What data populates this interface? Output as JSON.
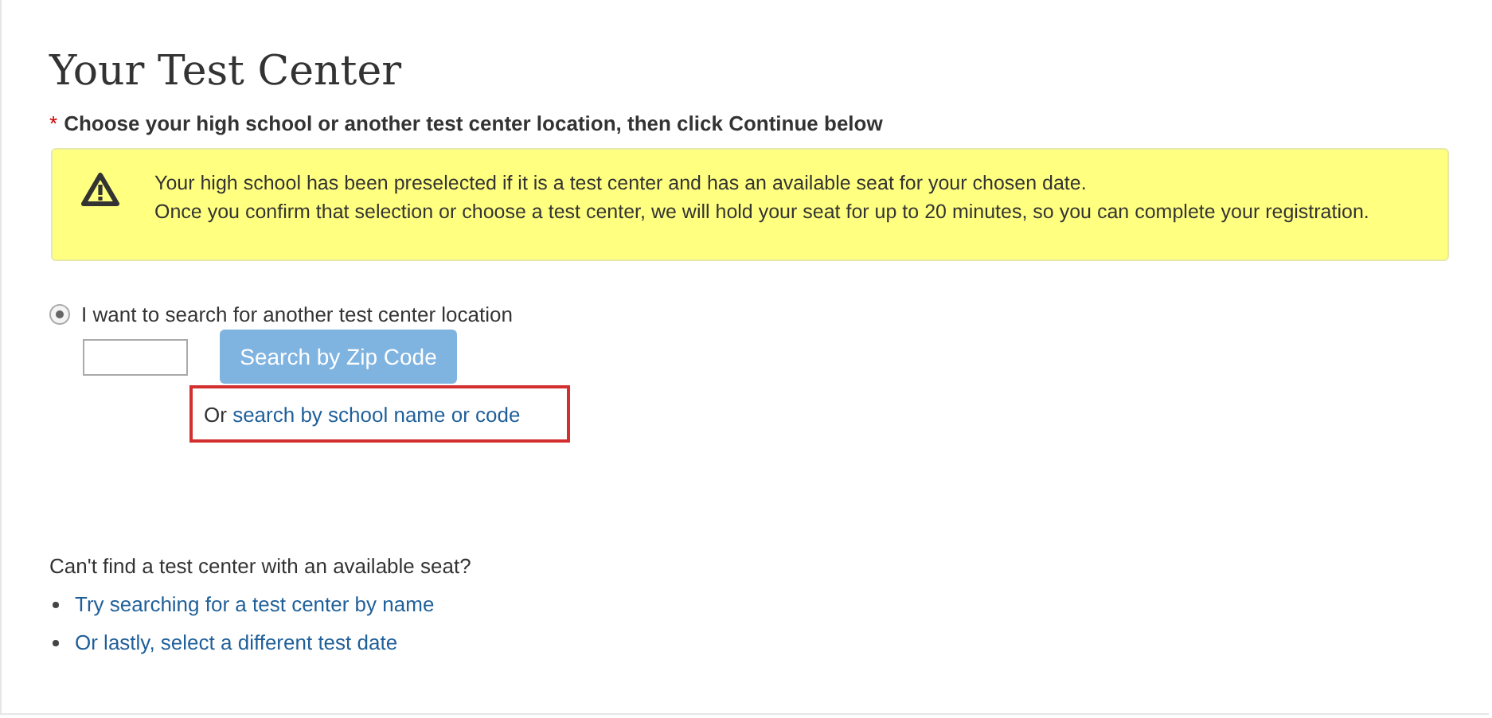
{
  "title": "Your Test Center",
  "instruction": {
    "required_mark": "*",
    "text": "Choose your high school or another test center location, then click Continue below"
  },
  "notice": {
    "lines": [
      "Your high school has been preselected if it is a test center and has an available seat for your chosen date.",
      "Once you confirm that selection or choose a test center, we will hold your seat for up to 20 minutes, so you can complete your registration."
    ]
  },
  "search_option": {
    "label": "I want to search for another test center location",
    "selected": true
  },
  "zip_button": {
    "label": "Search by Zip Code"
  },
  "alternative": {
    "prefix": "Or",
    "link": "search by school name or code",
    "highlighted": true
  },
  "help": {
    "question": "Can't find a test center with an available seat?",
    "links": [
      "Try searching for a test center by name",
      "Or lastly, select a different test date"
    ]
  }
}
